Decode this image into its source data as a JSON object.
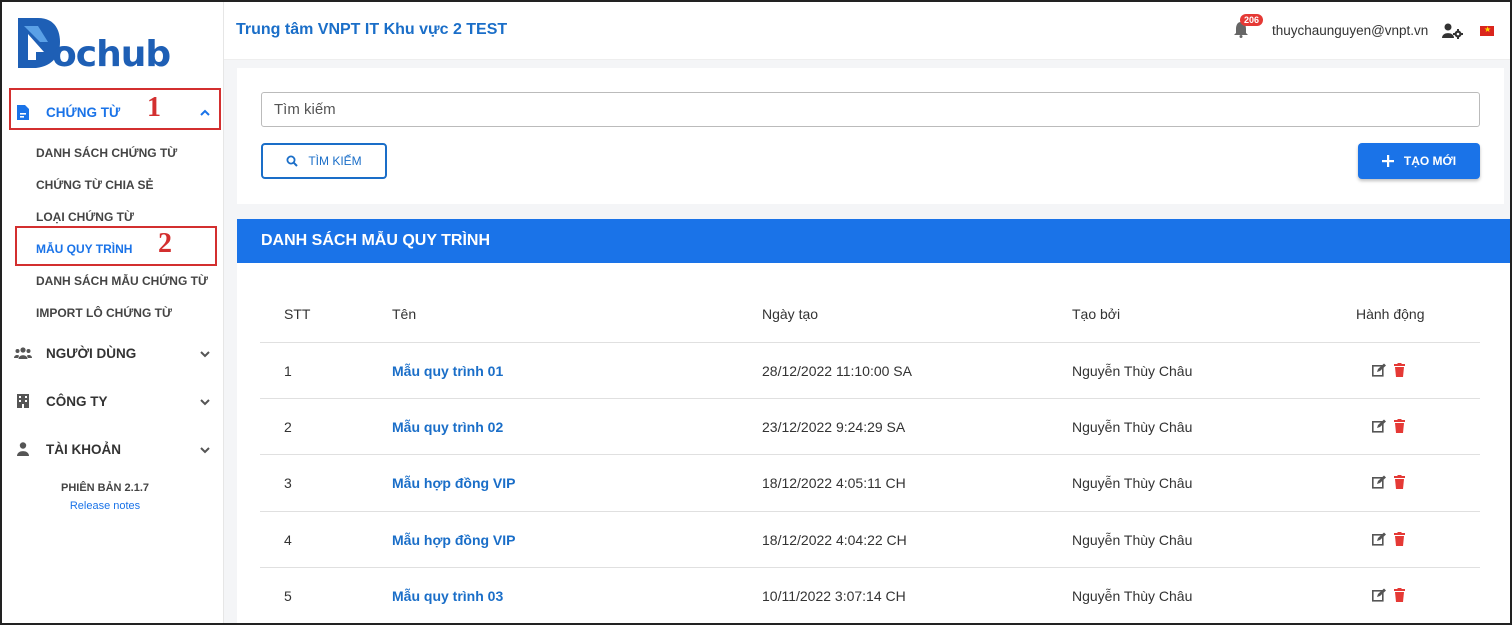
{
  "sidebar": {
    "logo_text": "ochub",
    "groups": [
      {
        "label": "CHỨNG TỪ",
        "icon": "file-icon",
        "expanded": true
      },
      {
        "label": "NGƯỜI DÙNG",
        "icon": "users-icon",
        "expanded": false
      },
      {
        "label": "CÔNG TY",
        "icon": "building-icon",
        "expanded": false
      },
      {
        "label": "TÀI KHOẢN",
        "icon": "user-icon",
        "expanded": false
      }
    ],
    "sub_items": [
      {
        "label": "DANH SÁCH CHỨNG TỪ"
      },
      {
        "label": "CHỨNG TỪ CHIA SẺ"
      },
      {
        "label": "LOẠI CHỨNG TỪ"
      },
      {
        "label": "MẪU QUY TRÌNH"
      },
      {
        "label": "DANH SÁCH MẪU CHỨNG TỪ"
      },
      {
        "label": "IMPORT LÔ CHỨNG TỪ"
      }
    ],
    "version": "PHIÊN BẢN 2.1.7",
    "release_notes": "Release notes",
    "annotations": [
      "1",
      "2"
    ]
  },
  "header": {
    "title": "Trung tâm VNPT IT Khu vực 2 TEST",
    "notification_count": "206",
    "user_email": "thuychaunguyen@vnpt.vn"
  },
  "search": {
    "placeholder": "Tìm kiếm",
    "search_button": "TÌM KIẾM",
    "create_button": "TẠO MỚI"
  },
  "list": {
    "title": "DANH SÁCH MẪU QUY TRÌNH",
    "columns": [
      "STT",
      "Tên",
      "Ngày tạo",
      "Tạo bởi",
      "Hành động"
    ],
    "rows": [
      {
        "stt": "1",
        "name": "Mẫu quy trình 01",
        "created": "28/12/2022 11:10:00 SA",
        "by": "Nguyễn Thùy Châu"
      },
      {
        "stt": "2",
        "name": "Mẫu quy trình 02",
        "created": "23/12/2022 9:24:29 SA",
        "by": "Nguyễn Thùy Châu"
      },
      {
        "stt": "3",
        "name": "Mẫu hợp đồng VIP",
        "created": "18/12/2022 4:05:11 CH",
        "by": "Nguyễn Thùy Châu"
      },
      {
        "stt": "4",
        "name": "Mẫu hợp đồng VIP",
        "created": "18/12/2022 4:04:22 CH",
        "by": "Nguyễn Thùy Châu"
      },
      {
        "stt": "5",
        "name": "Mẫu quy trình 03",
        "created": "10/11/2022 3:07:14 CH",
        "by": "Nguyễn Thùy Châu"
      }
    ]
  },
  "colors": {
    "accent": "#1a73e8",
    "annotation": "#d32f2f",
    "delete": "#e53935"
  }
}
